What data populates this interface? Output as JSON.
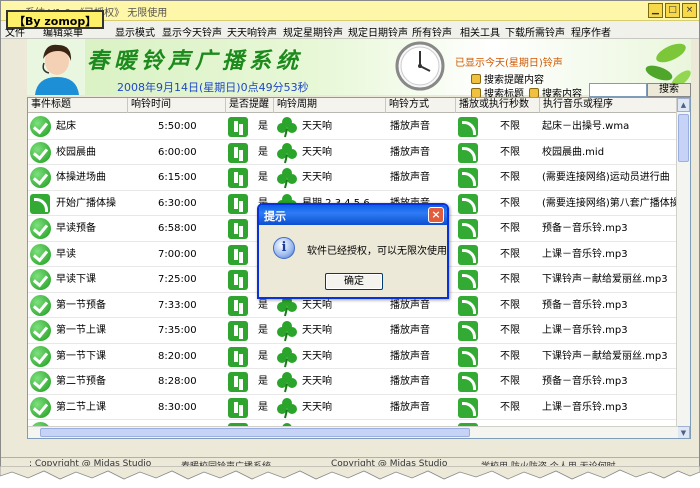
{
  "watermark": "【By zomop】",
  "window": {
    "title": "系统 V1.0 《已授权》 无限使用"
  },
  "menu": [
    "文件",
    "编辑菜单",
    "显示模式",
    "显示今天铃声",
    "天天响铃声",
    "规定星期铃声",
    "规定日期铃声",
    "所有铃声",
    "相关工具",
    "下载所需铃声",
    "程序作者"
  ],
  "banner": {
    "title": "春暖铃声广播系统",
    "date": "2008年9月14日(星期日)0点49分53秒",
    "show_today": "已显示今天(星期日)铃声"
  },
  "search": {
    "options": [
      "搜索提醒内容",
      "搜索标题",
      "搜索内容"
    ],
    "button": "搜索",
    "value": ""
  },
  "columns": [
    "事件标题",
    "响铃时间",
    "是否提醒",
    "响铃周期",
    "响铃方式",
    "播放或执行秒数",
    "执行音乐或程序"
  ],
  "rows": [
    {
      "icon": "check",
      "title": "起床",
      "time": "5:50:00",
      "remind": "是",
      "cycle": "天天响",
      "mode": "播放声音",
      "secs": "不限",
      "file": "起床－出操号.wma"
    },
    {
      "icon": "check",
      "title": "校园晨曲",
      "time": "6:00:00",
      "remind": "是",
      "cycle": "天天响",
      "mode": "播放声音",
      "secs": "不限",
      "file": "校园晨曲.mid"
    },
    {
      "icon": "check",
      "title": "体操进场曲",
      "time": "6:15:00",
      "remind": "是",
      "cycle": "天天响",
      "mode": "播放声音",
      "secs": "不限",
      "file": "(需要连接网络)运动员进行曲"
    },
    {
      "icon": "broadcast",
      "title": "开始广播体操",
      "time": "6:30:00",
      "remind": "是",
      "cycle": "星期 2,3,4,5,6",
      "mode": "播放声音",
      "secs": "不限",
      "file": "(需要连接网络)第八套广播体操"
    },
    {
      "icon": "check",
      "title": "早读预备",
      "time": "6:58:00",
      "remind": "是",
      "cycle": "天天响",
      "mode": "播放声音",
      "secs": "不限",
      "file": "预备－音乐铃.mp3"
    },
    {
      "icon": "check",
      "title": "早读",
      "time": "7:00:00",
      "remind": "是",
      "cycle": "天天响",
      "mode": "播放声音",
      "secs": "不限",
      "file": "上课－音乐铃.mp3"
    },
    {
      "icon": "check",
      "title": "早读下课",
      "time": "7:25:00",
      "remind": "是",
      "cycle": "天天响",
      "mode": "播放声音",
      "secs": "不限",
      "file": "下课铃声－献给爱丽丝.mp3"
    },
    {
      "icon": "check",
      "title": "第一节预备",
      "time": "7:33:00",
      "remind": "是",
      "cycle": "天天响",
      "mode": "播放声音",
      "secs": "不限",
      "file": "预备－音乐铃.mp3"
    },
    {
      "icon": "check",
      "title": "第一节上课",
      "time": "7:35:00",
      "remind": "是",
      "cycle": "天天响",
      "mode": "播放声音",
      "secs": "不限",
      "file": "上课－音乐铃.mp3"
    },
    {
      "icon": "check",
      "title": "第一节下课",
      "time": "8:20:00",
      "remind": "是",
      "cycle": "天天响",
      "mode": "播放声音",
      "secs": "不限",
      "file": "下课铃声－献给爱丽丝.mp3"
    },
    {
      "icon": "check",
      "title": "第二节预备",
      "time": "8:28:00",
      "remind": "是",
      "cycle": "天天响",
      "mode": "播放声音",
      "secs": "不限",
      "file": "预备－音乐铃.mp3"
    },
    {
      "icon": "check",
      "title": "第二节上课",
      "time": "8:30:00",
      "remind": "是",
      "cycle": "天天响",
      "mode": "播放声音",
      "secs": "不限",
      "file": "上课－音乐铃.mp3"
    },
    {
      "icon": "check",
      "title": "第二节下课",
      "time": "9:15:00",
      "remind": "是",
      "cycle": "天天响",
      "mode": "播放声音",
      "secs": "不限",
      "file": "下课铃声－献给爱丽丝.mp3"
    }
  ],
  "status": [
    ": Copyright @ Midas Studio",
    "春暖校园铃声广播系统",
    "Copyright @ Midas Studio",
    "学校用,防火防盗,个人用,无论何时"
  ],
  "dialog": {
    "title": "提示",
    "message": "软件已经授权，可以无限次使用",
    "ok": "确定"
  },
  "colors": {
    "accent_green": "#1d8a1d",
    "date_blue": "#1f47c8",
    "dialog_title": "#0a5fe8"
  }
}
